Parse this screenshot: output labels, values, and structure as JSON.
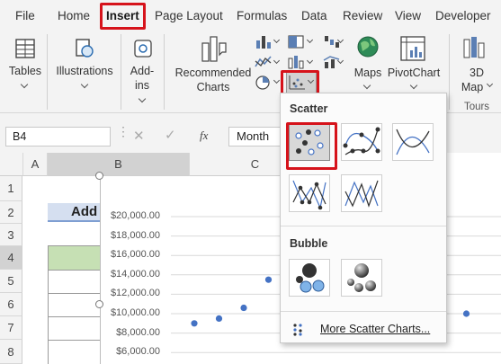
{
  "menu": {
    "tabs": [
      "File",
      "Home",
      "Insert",
      "Page Layout",
      "Formulas",
      "Data",
      "Review",
      "View",
      "Developer"
    ]
  },
  "ribbon": {
    "tables": "Tables",
    "illustrations": "Illustrations",
    "addins_line1": "Add-",
    "addins_line2": "ins",
    "recommended_line1": "Recommended",
    "recommended_line2": "Charts",
    "maps": "Maps",
    "pivotchart": "PivotChart",
    "map3d_line1": "3D",
    "map3d_line2": "Map",
    "tours": "Tours"
  },
  "formula_bar": {
    "name_box": "B4",
    "formula": "Month"
  },
  "grid": {
    "columns": [
      "A",
      "B",
      "C"
    ],
    "rows": [
      "1",
      "2",
      "3",
      "4",
      "5",
      "6",
      "7",
      "8"
    ],
    "b2_text": "Add"
  },
  "chart_data": {
    "type": "scatter",
    "ylim": [
      6000,
      20000
    ],
    "y_ticks": [
      "$20,000.00",
      "$18,000.00",
      "$16,000.00",
      "$14,000.00",
      "$12,000.00",
      "$10,000.00",
      "$8,000.00",
      "$6,000.00"
    ],
    "points": [
      {
        "x": 1,
        "y": 9000
      },
      {
        "x": 2,
        "y": 9500
      },
      {
        "x": 3,
        "y": 10600
      },
      {
        "x": 4,
        "y": 13500
      },
      {
        "x": 12,
        "y": 10000
      }
    ],
    "marker_color": "#4472c4"
  },
  "dropdown": {
    "scatter_title": "Scatter",
    "bubble_title": "Bubble",
    "more_label": "More Scatter Charts..."
  },
  "colors": {
    "accent_red": "#d6131b",
    "ribbon_bg": "#f3f3f3",
    "green_fill": "#c6e0b4"
  }
}
